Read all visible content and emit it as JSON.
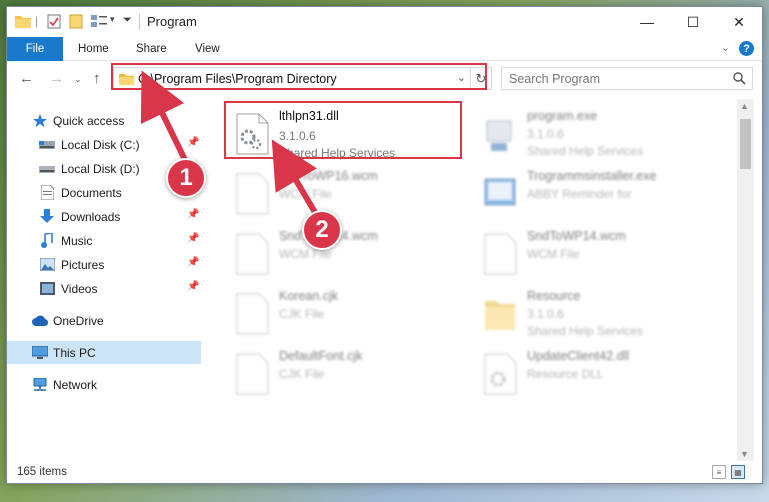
{
  "window": {
    "title": "Program",
    "controls": {
      "minimize": "—",
      "maximize": "☐",
      "close": "✕"
    }
  },
  "ribbon": {
    "tabs": [
      "File",
      "Home",
      "Share",
      "View"
    ],
    "help": "?"
  },
  "address": {
    "path": "C:\\Program Files\\Program Directory",
    "search_placeholder": "Search Program"
  },
  "sidebar": {
    "items": [
      {
        "label": "Quick access",
        "icon": "star-icon",
        "pinned": false
      },
      {
        "label": "Local Disk (C:)",
        "icon": "drive-icon",
        "pinned": true
      },
      {
        "label": "Local Disk (D:)",
        "icon": "drive-icon",
        "pinned": true
      },
      {
        "label": "Documents",
        "icon": "documents-icon",
        "pinned": true
      },
      {
        "label": "Downloads",
        "icon": "download-icon",
        "pinned": true
      },
      {
        "label": "Music",
        "icon": "music-icon",
        "pinned": true
      },
      {
        "label": "Pictures",
        "icon": "pictures-icon",
        "pinned": true
      },
      {
        "label": "Videos",
        "icon": "videos-icon",
        "pinned": true
      },
      {
        "label": "OneDrive",
        "icon": "cloud-icon",
        "pinned": false
      },
      {
        "label": "This PC",
        "icon": "computer-icon",
        "pinned": false,
        "selected": true
      },
      {
        "label": "Network",
        "icon": "network-icon",
        "pinned": false
      }
    ]
  },
  "files": [
    {
      "name": "lthlpn31.dll",
      "line1": "3.1.0.6",
      "line2": "Shared Help Services",
      "highlighted": true
    },
    {
      "name": "program.exe",
      "line1": "3.1.0.6",
      "line2": "Shared Help Services"
    },
    {
      "name": "SndToWP16.wcm",
      "line1": "WCM File",
      "line2": ""
    },
    {
      "name": "Trogrammsinstaller.exe",
      "line1": "ABBY Reminder for",
      "line2": ""
    },
    {
      "name": "SndToWP14.wcm",
      "line1": "WCM File",
      "line2": ""
    },
    {
      "name": "SndToWP14.wcm",
      "line1": "WCM File",
      "line2": ""
    },
    {
      "name": "Korean.cjk",
      "line1": "CJK File",
      "line2": ""
    },
    {
      "name": "Resource",
      "line1": "3.1.0.6",
      "line2": "Shared Help Services"
    },
    {
      "name": "DefaultFont.cjk",
      "line1": "CJK File",
      "line2": ""
    },
    {
      "name": "UpdateClient42.dll",
      "line1": "Resource DLL",
      "line2": ""
    }
  ],
  "status": {
    "items": "165 items"
  },
  "callouts": [
    "1",
    "2"
  ],
  "colors": {
    "accent": "#1979ca",
    "highlight": "#d9364a",
    "selected": "#cce4f7"
  }
}
